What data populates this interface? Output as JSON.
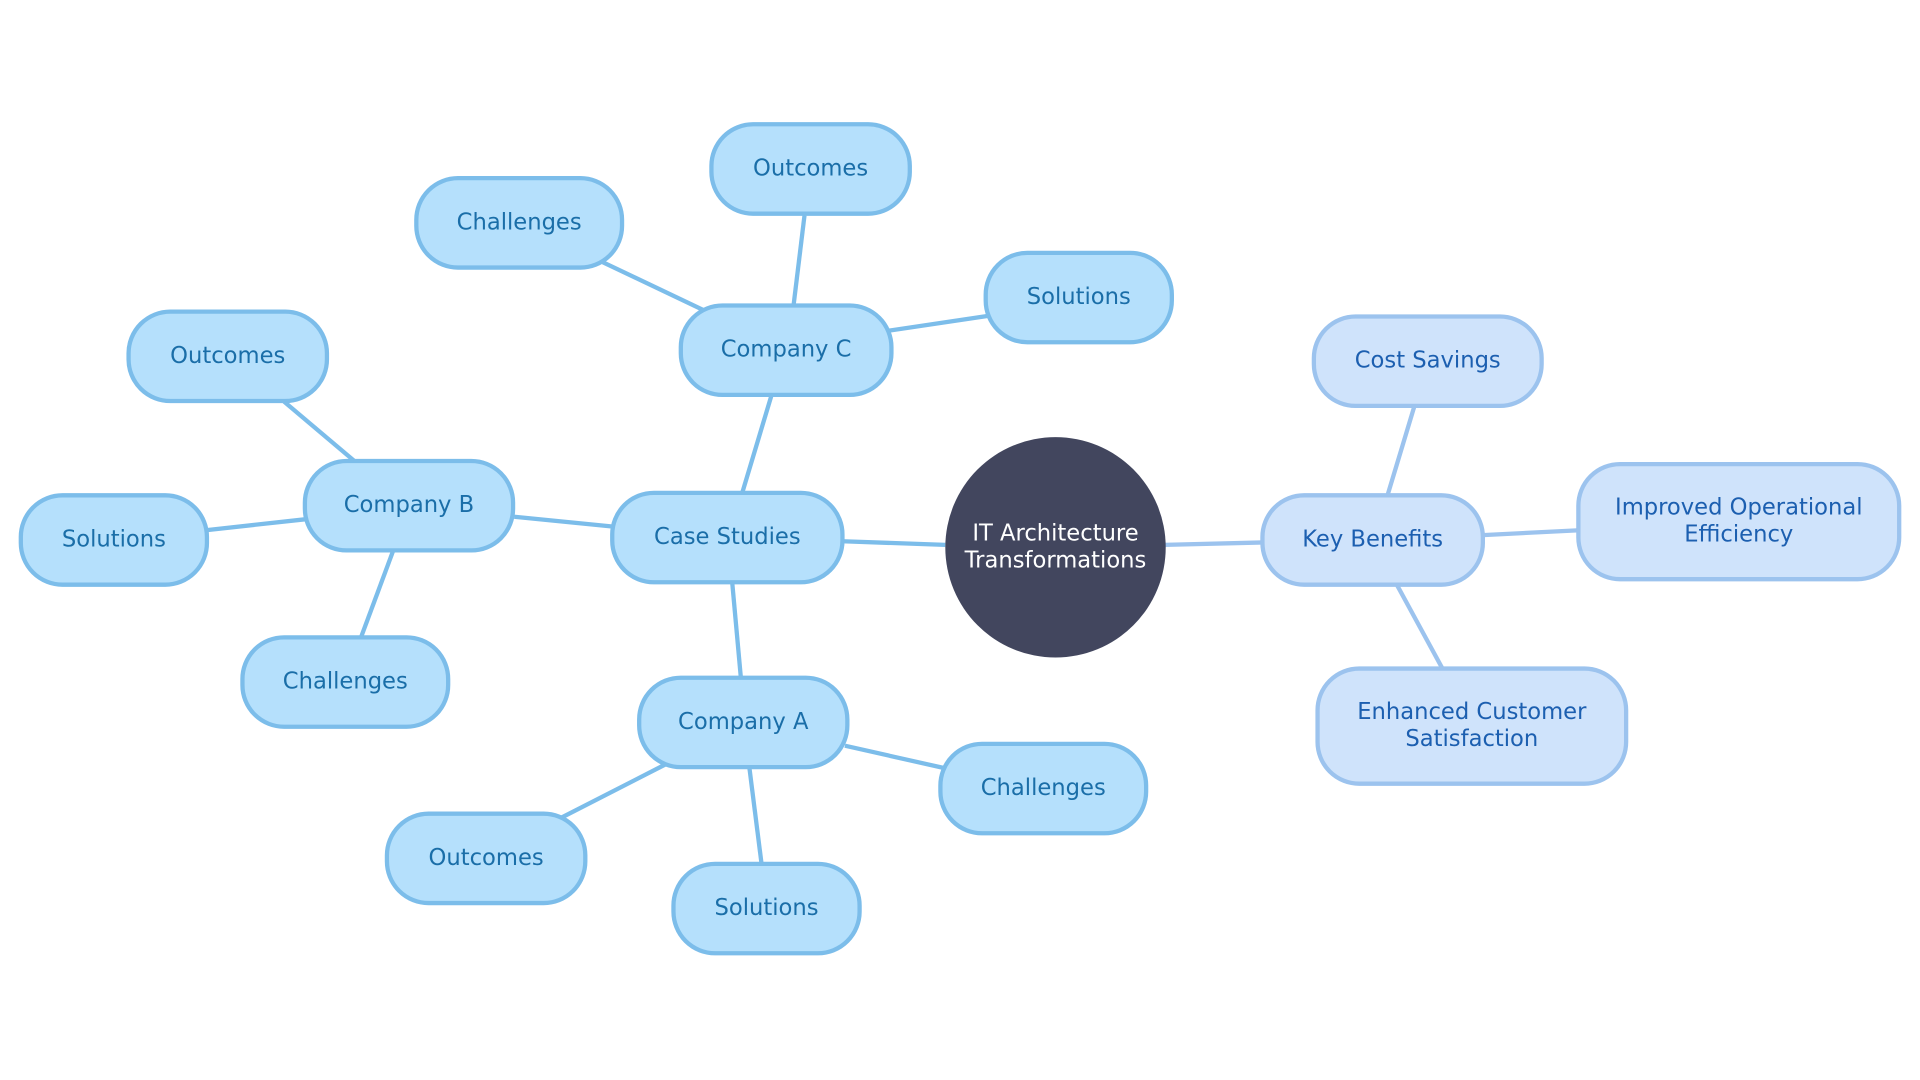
{
  "diagram": {
    "type": "mindmap",
    "root": {
      "id": "root",
      "lines": [
        "IT Architecture",
        "Transformations"
      ]
    },
    "nodes": [
      {
        "id": "case",
        "parent": "root",
        "group": "case",
        "lines": [
          "Case Studies"
        ]
      },
      {
        "id": "compA",
        "parent": "case",
        "group": "case",
        "lines": [
          "Company A"
        ]
      },
      {
        "id": "compB",
        "parent": "case",
        "group": "case",
        "lines": [
          "Company B"
        ]
      },
      {
        "id": "compC",
        "parent": "case",
        "group": "case",
        "lines": [
          "Company C"
        ]
      },
      {
        "id": "a-chal",
        "parent": "compA",
        "group": "case",
        "lines": [
          "Challenges"
        ]
      },
      {
        "id": "a-sol",
        "parent": "compA",
        "group": "case",
        "lines": [
          "Solutions"
        ]
      },
      {
        "id": "a-out",
        "parent": "compA",
        "group": "case",
        "lines": [
          "Outcomes"
        ]
      },
      {
        "id": "b-out",
        "parent": "compB",
        "group": "case",
        "lines": [
          "Outcomes"
        ]
      },
      {
        "id": "b-sol",
        "parent": "compB",
        "group": "case",
        "lines": [
          "Solutions"
        ]
      },
      {
        "id": "b-chal",
        "parent": "compB",
        "group": "case",
        "lines": [
          "Challenges"
        ]
      },
      {
        "id": "c-chal",
        "parent": "compC",
        "group": "case",
        "lines": [
          "Challenges"
        ]
      },
      {
        "id": "c-out",
        "parent": "compC",
        "group": "case",
        "lines": [
          "Outcomes"
        ]
      },
      {
        "id": "c-sol",
        "parent": "compC",
        "group": "case",
        "lines": [
          "Solutions"
        ]
      },
      {
        "id": "kb",
        "parent": "root",
        "group": "benefits",
        "lines": [
          "Key Benefits"
        ]
      },
      {
        "id": "kb-cost",
        "parent": "kb",
        "group": "benefits",
        "lines": [
          "Cost Savings"
        ]
      },
      {
        "id": "kb-eff",
        "parent": "kb",
        "group": "benefits",
        "lines": [
          "Improved Operational",
          "Efficiency"
        ]
      },
      {
        "id": "kb-cust",
        "parent": "kb",
        "group": "benefits",
        "lines": [
          "Enhanced Customer",
          "Satisfaction"
        ]
      }
    ],
    "colors": {
      "root_fill": "#42465e",
      "case_fill": "#b5e0fc",
      "case_stroke": "#7cbdea",
      "case_text": "#1a6ea8",
      "benefits_fill": "#cfe3fb",
      "benefits_stroke": "#9cc3ee",
      "benefits_text": "#1c5fb0"
    }
  }
}
